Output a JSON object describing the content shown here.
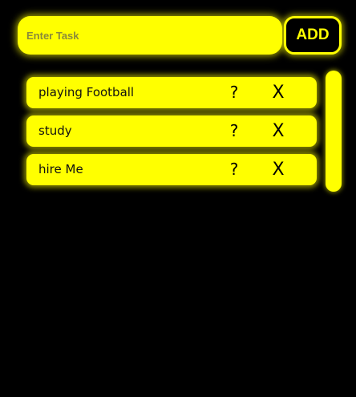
{
  "input": {
    "placeholder": "Enter Task",
    "value": ""
  },
  "add_button": {
    "label": "ADD"
  },
  "tasks": [
    {
      "text": "playing Football",
      "edit": "?",
      "delete": "X"
    },
    {
      "text": "study",
      "edit": "?",
      "delete": "X"
    },
    {
      "text": "hire Me",
      "edit": "?",
      "delete": "X"
    }
  ],
  "colors": {
    "background": "#000000",
    "accent": "#ffff00",
    "text": "#111111"
  }
}
